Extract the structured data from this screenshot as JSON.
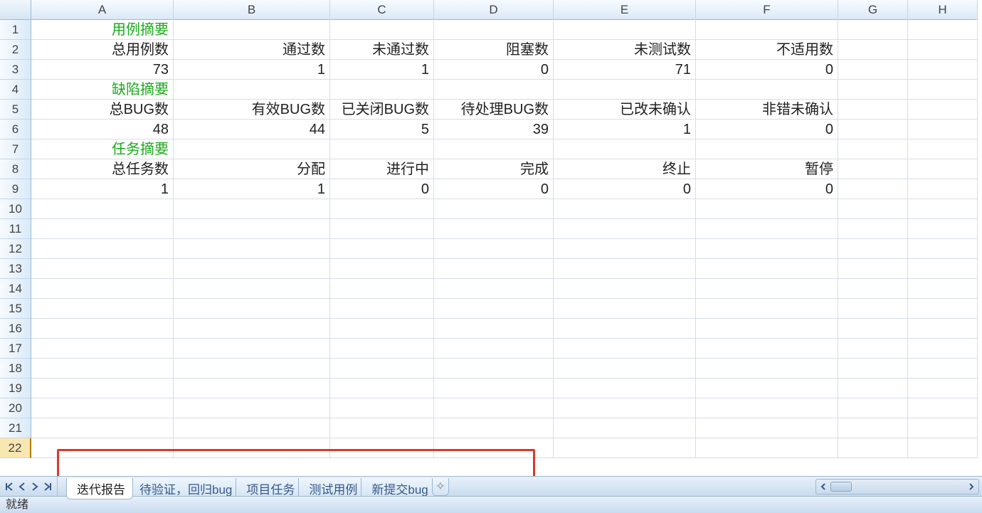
{
  "columns": [
    "A",
    "B",
    "C",
    "D",
    "E",
    "F",
    "G",
    "H"
  ],
  "rowCount": 22,
  "activeRow": 22,
  "sections": {
    "caseSummary": {
      "title": "用例摘要",
      "headers": [
        "总用例数",
        "通过数",
        "未通过数",
        "阻塞数",
        "未测试数",
        "不适用数"
      ],
      "values": [
        "73",
        "1",
        "1",
        "0",
        "71",
        "0"
      ]
    },
    "bugSummary": {
      "title": "缺陷摘要",
      "headers": [
        "总BUG数",
        "有效BUG数",
        "已关闭BUG数",
        "待处理BUG数",
        "已改未确认",
        "非错未确认"
      ],
      "values": [
        "48",
        "44",
        "5",
        "39",
        "1",
        "0"
      ]
    },
    "taskSummary": {
      "title": "任务摘要",
      "headers": [
        "总任务数",
        "分配",
        "进行中",
        "完成",
        "终止",
        "暂停"
      ],
      "values": [
        "1",
        "1",
        "0",
        "0",
        "0",
        "0"
      ]
    }
  },
  "sheetTabs": {
    "active": "迭代报告",
    "items": [
      "迭代报告",
      "待验证，回归bug",
      "项目任务",
      "测试用例",
      "新提交bug"
    ]
  },
  "status": "就绪"
}
